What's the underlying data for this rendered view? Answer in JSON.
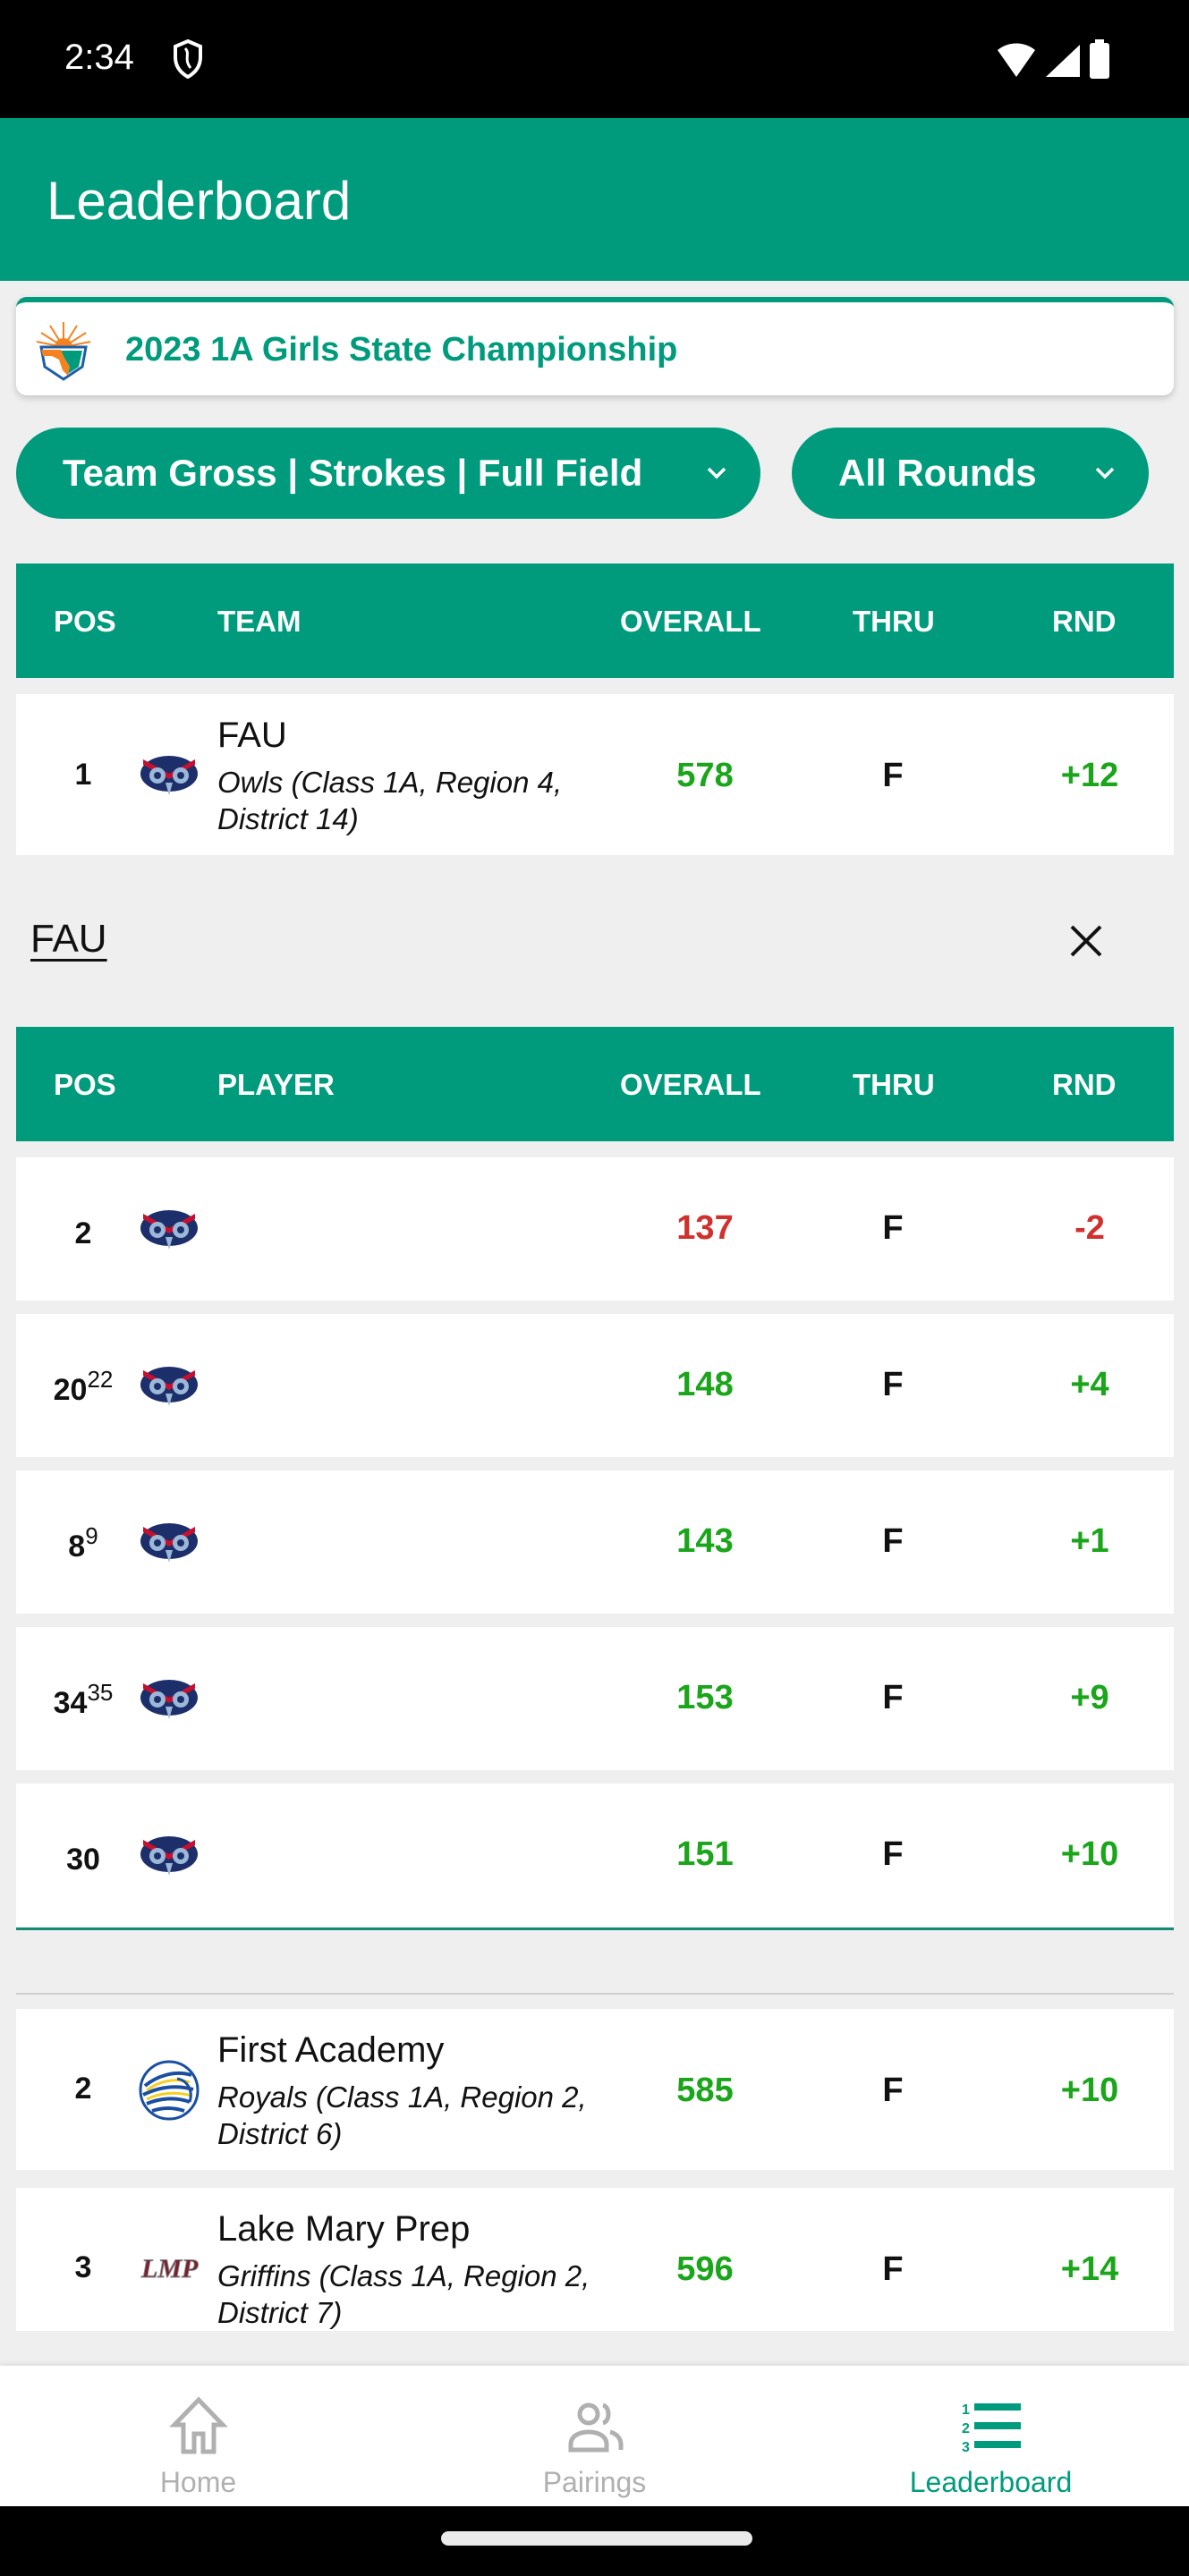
{
  "status_bar": {
    "time": "2:34"
  },
  "app_bar": {
    "title": "Leaderboard"
  },
  "tournament": {
    "name": "2023 1A Girls State Championship"
  },
  "filters": {
    "scoring": "Team Gross | Strokes | Full Field",
    "rounds": "All Rounds"
  },
  "team_table": {
    "headers": {
      "pos": "POS",
      "name": "TEAM",
      "overall": "OVERALL",
      "thru": "THRU",
      "rnd": "RND"
    }
  },
  "player_table": {
    "headers": {
      "pos": "POS",
      "name": "PLAYER",
      "overall": "OVERALL",
      "thru": "THRU",
      "rnd": "RND"
    }
  },
  "expanded_team": {
    "title": "FAU",
    "team": {
      "pos": "1",
      "name": "FAU",
      "sub": "Owls (Class 1A, Region 4, District 14)",
      "overall": "578",
      "thru": "F",
      "rnd": "+12",
      "logo": "fau-owl-logo"
    },
    "players": [
      {
        "pos": "2",
        "pos_sup": "",
        "overall": "137",
        "thru": "F",
        "rnd": "-2",
        "status": "under"
      },
      {
        "pos": "20",
        "pos_sup": "22",
        "overall": "148",
        "thru": "F",
        "rnd": "+4",
        "status": "over"
      },
      {
        "pos": "8",
        "pos_sup": "9",
        "overall": "143",
        "thru": "F",
        "rnd": "+1",
        "status": "over"
      },
      {
        "pos": "34",
        "pos_sup": "35",
        "overall": "153",
        "thru": "F",
        "rnd": "+9",
        "status": "over"
      },
      {
        "pos": "30",
        "pos_sup": "",
        "overall": "151",
        "thru": "F",
        "rnd": "+10",
        "status": "over"
      }
    ]
  },
  "other_teams": [
    {
      "pos": "2",
      "name": "First Academy",
      "sub": "Royals (Class 1A, Region 2, District 6)",
      "overall": "585",
      "thru": "F",
      "rnd": "+10",
      "logo": "first-academy-lion-logo"
    },
    {
      "pos": "3",
      "name": "Lake Mary Prep",
      "sub": "Griffins (Class 1A, Region 2, District 7)",
      "overall": "596",
      "thru": "F",
      "rnd": "+14",
      "logo": "lmp-logo"
    }
  ],
  "bottom_nav": {
    "items": [
      {
        "label": "Home",
        "icon": "home-icon",
        "active": false
      },
      {
        "label": "Pairings",
        "icon": "people-icon",
        "active": false
      },
      {
        "label": "Leaderboard",
        "icon": "ranked-list-icon",
        "active": true
      }
    ]
  },
  "colors": {
    "brand": "#009b7d",
    "over_par": "#1aa51a",
    "under_par": "#d0312d",
    "inactive": "#b0b0b0"
  }
}
